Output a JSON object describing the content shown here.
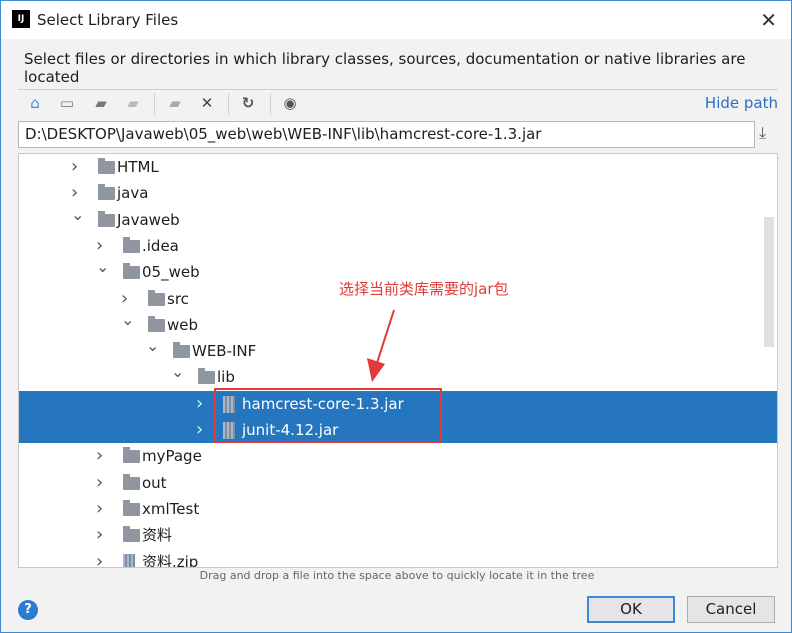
{
  "window": {
    "title": "Select Library Files",
    "app_icon": "IJ"
  },
  "description": "Select files or directories in which library classes, sources, documentation or native libraries are located",
  "toolbar": {
    "icons": [
      "home-icon",
      "desktop-icon",
      "project-folder-icon",
      "module-folder-icon",
      "new-folder-icon",
      "delete-icon",
      "refresh-icon",
      "show-hidden-icon"
    ],
    "hide_path": "Hide path"
  },
  "path": "D:\\DESKTOP\\Javaweb\\05_web\\web\\WEB-INF\\lib\\hamcrest-core-1.3.jar",
  "tree": [
    {
      "label": "HTML",
      "level": 0,
      "type": "folder",
      "state": "collapsed"
    },
    {
      "label": "java",
      "level": 0,
      "type": "folder",
      "state": "collapsed"
    },
    {
      "label": "Javaweb",
      "level": 0,
      "type": "folder",
      "state": "expanded"
    },
    {
      "label": ".idea",
      "level": 1,
      "type": "folder",
      "state": "collapsed"
    },
    {
      "label": "05_web",
      "level": 1,
      "type": "folder",
      "state": "expanded"
    },
    {
      "label": "src",
      "level": 2,
      "type": "folder",
      "state": "collapsed"
    },
    {
      "label": "web",
      "level": 2,
      "type": "folder",
      "state": "expanded"
    },
    {
      "label": "WEB-INF",
      "level": 3,
      "type": "folder",
      "state": "expanded"
    },
    {
      "label": "lib",
      "level": 4,
      "type": "folder",
      "state": "expanded"
    },
    {
      "label": "hamcrest-core-1.3.jar",
      "level": 5,
      "type": "jar",
      "state": "collapsed",
      "selected": true
    },
    {
      "label": "junit-4.12.jar",
      "level": 5,
      "type": "jar",
      "state": "collapsed",
      "selected": true
    },
    {
      "label": "myPage",
      "level": 1,
      "type": "folder",
      "state": "collapsed"
    },
    {
      "label": "out",
      "level": 1,
      "type": "folder",
      "state": "collapsed"
    },
    {
      "label": "xmlTest",
      "level": 1,
      "type": "folder",
      "state": "collapsed"
    },
    {
      "label": "资料",
      "level": 1,
      "type": "folder",
      "state": "collapsed"
    },
    {
      "label": "资料.zip",
      "level": 1,
      "type": "jar",
      "state": "collapsed"
    }
  ],
  "annotation": "选择当前类库需要的jar包",
  "hint": "Drag and drop a file into the space above to quickly locate it in the tree",
  "buttons": {
    "help": "?",
    "ok": "OK",
    "cancel": "Cancel"
  },
  "colors": {
    "selection": "#2675bf",
    "annotation": "#e03a3a",
    "link": "#2b6fc2"
  }
}
